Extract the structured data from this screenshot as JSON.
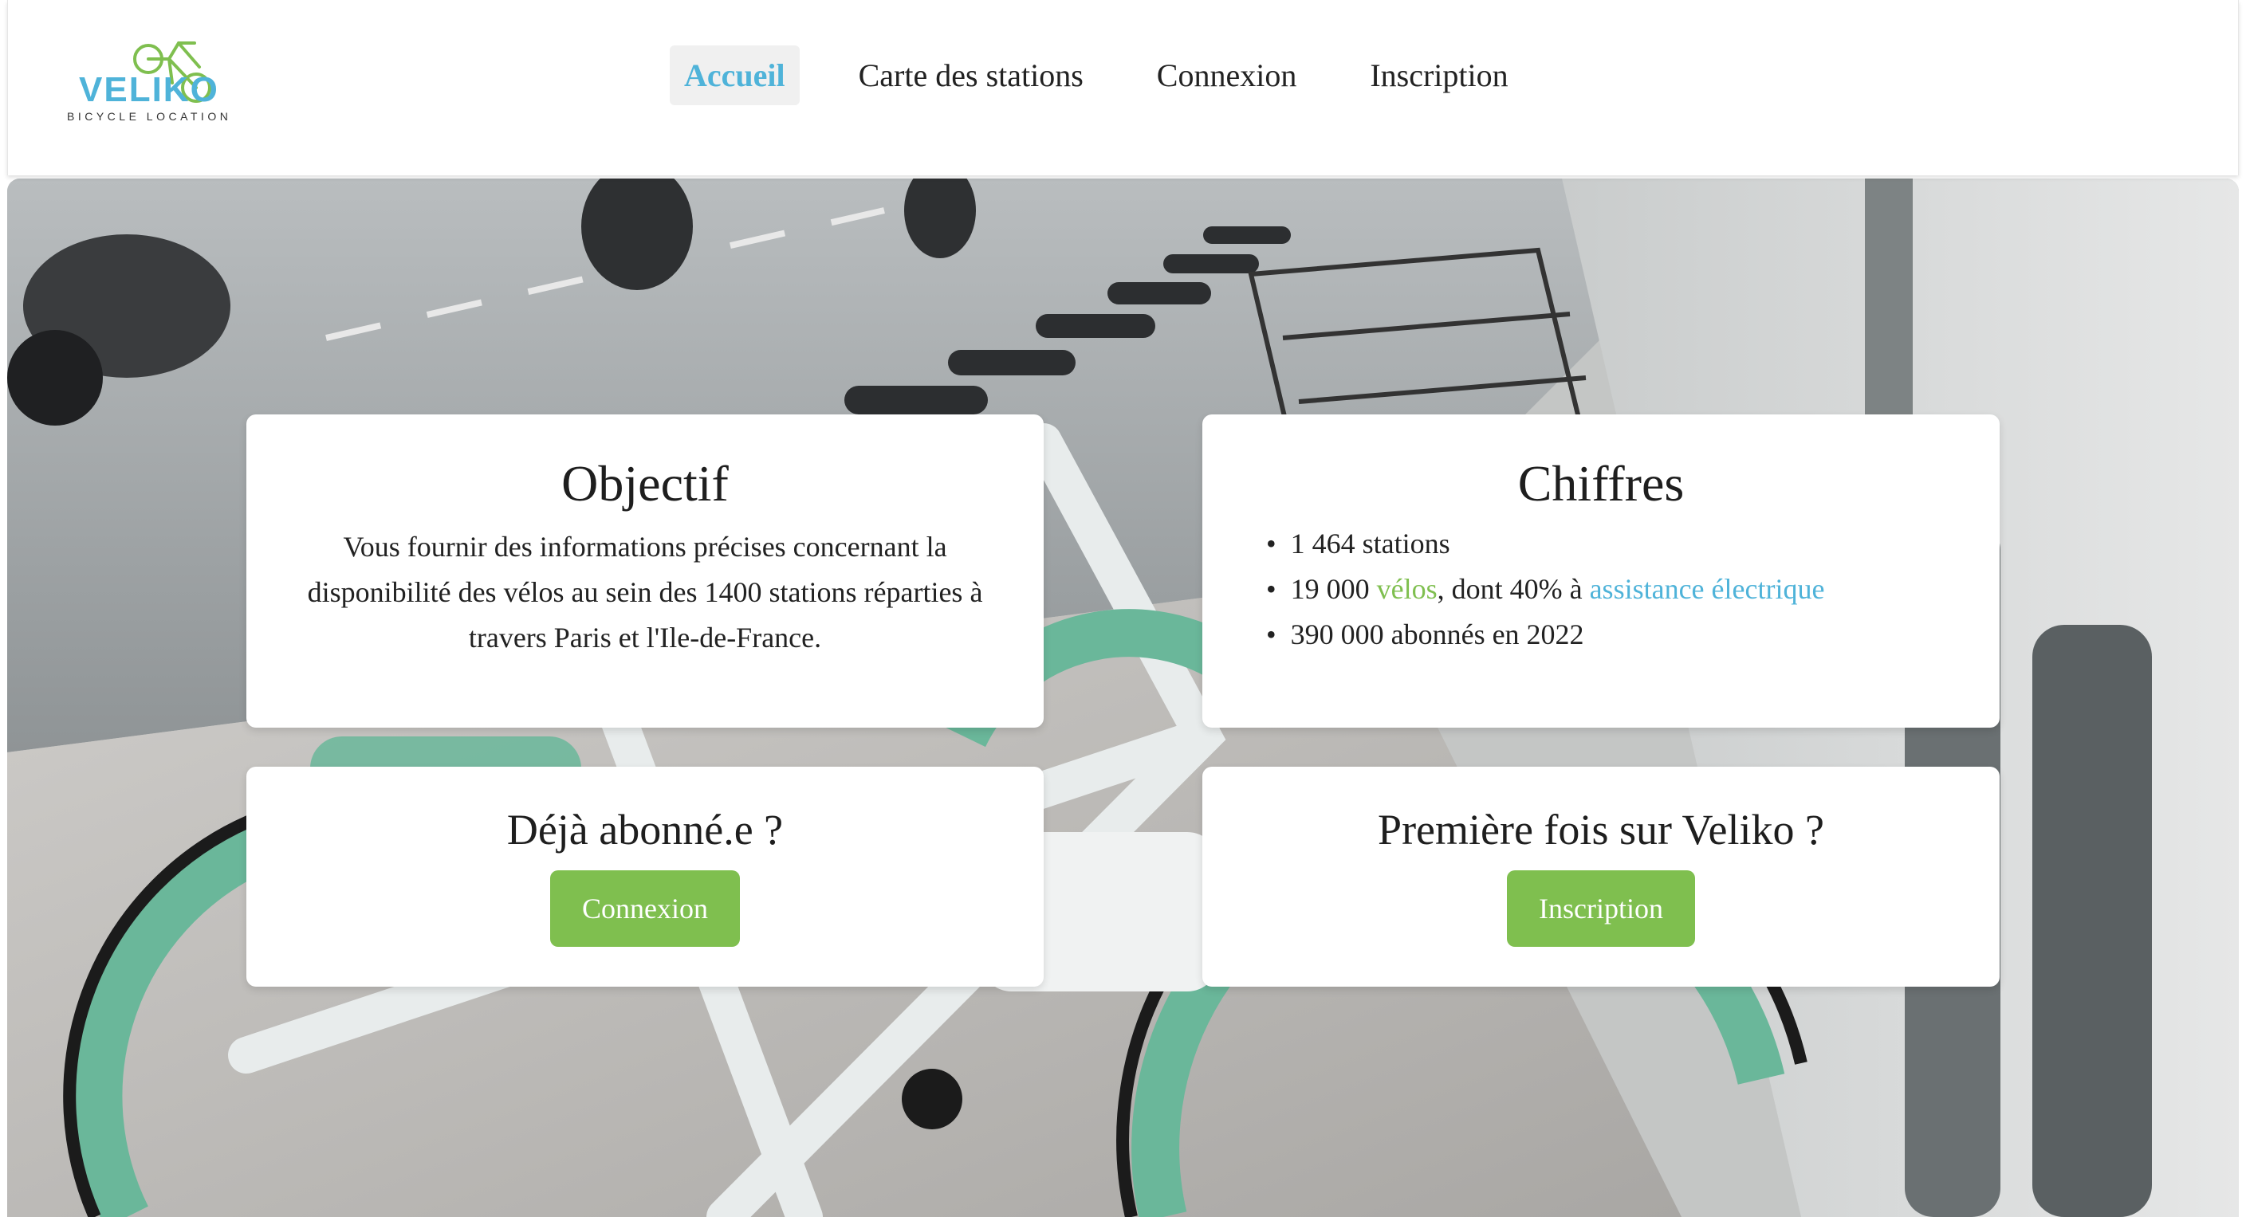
{
  "brand": {
    "name": "VELIKO",
    "tagline": "BICYCLE LOCATION",
    "logo_icon": "bicycle-icon",
    "primary_color": "#4fb3d9",
    "accent_color": "#7fbf4f"
  },
  "nav": {
    "items": [
      {
        "label": "Accueil",
        "active": true
      },
      {
        "label": "Carte des stations",
        "active": false
      },
      {
        "label": "Connexion",
        "active": false
      },
      {
        "label": "Inscription",
        "active": false
      }
    ]
  },
  "hero": {
    "background": "photo of shared bikes docked at a station along a street"
  },
  "objectif": {
    "title": "Objectif",
    "text": "Vous fournir des informations précises concernant la disponibilité des vélos au sein des 1400 stations réparties à travers Paris et l'Ile-de-France."
  },
  "chiffres": {
    "title": "Chiffres",
    "items": {
      "stations": "1 464 stations",
      "velos_prefix": "19 000 ",
      "velos_highlight": "vélos",
      "velos_middle": ", dont 40% à ",
      "velos_electric": "assistance électrique",
      "abonnes": "390 000 abonnés en 2022"
    }
  },
  "abonne": {
    "title": "Déjà abonné.e ?",
    "button": "Connexion"
  },
  "premiere": {
    "title": "Première fois sur Veliko ?",
    "button": "Inscription"
  }
}
